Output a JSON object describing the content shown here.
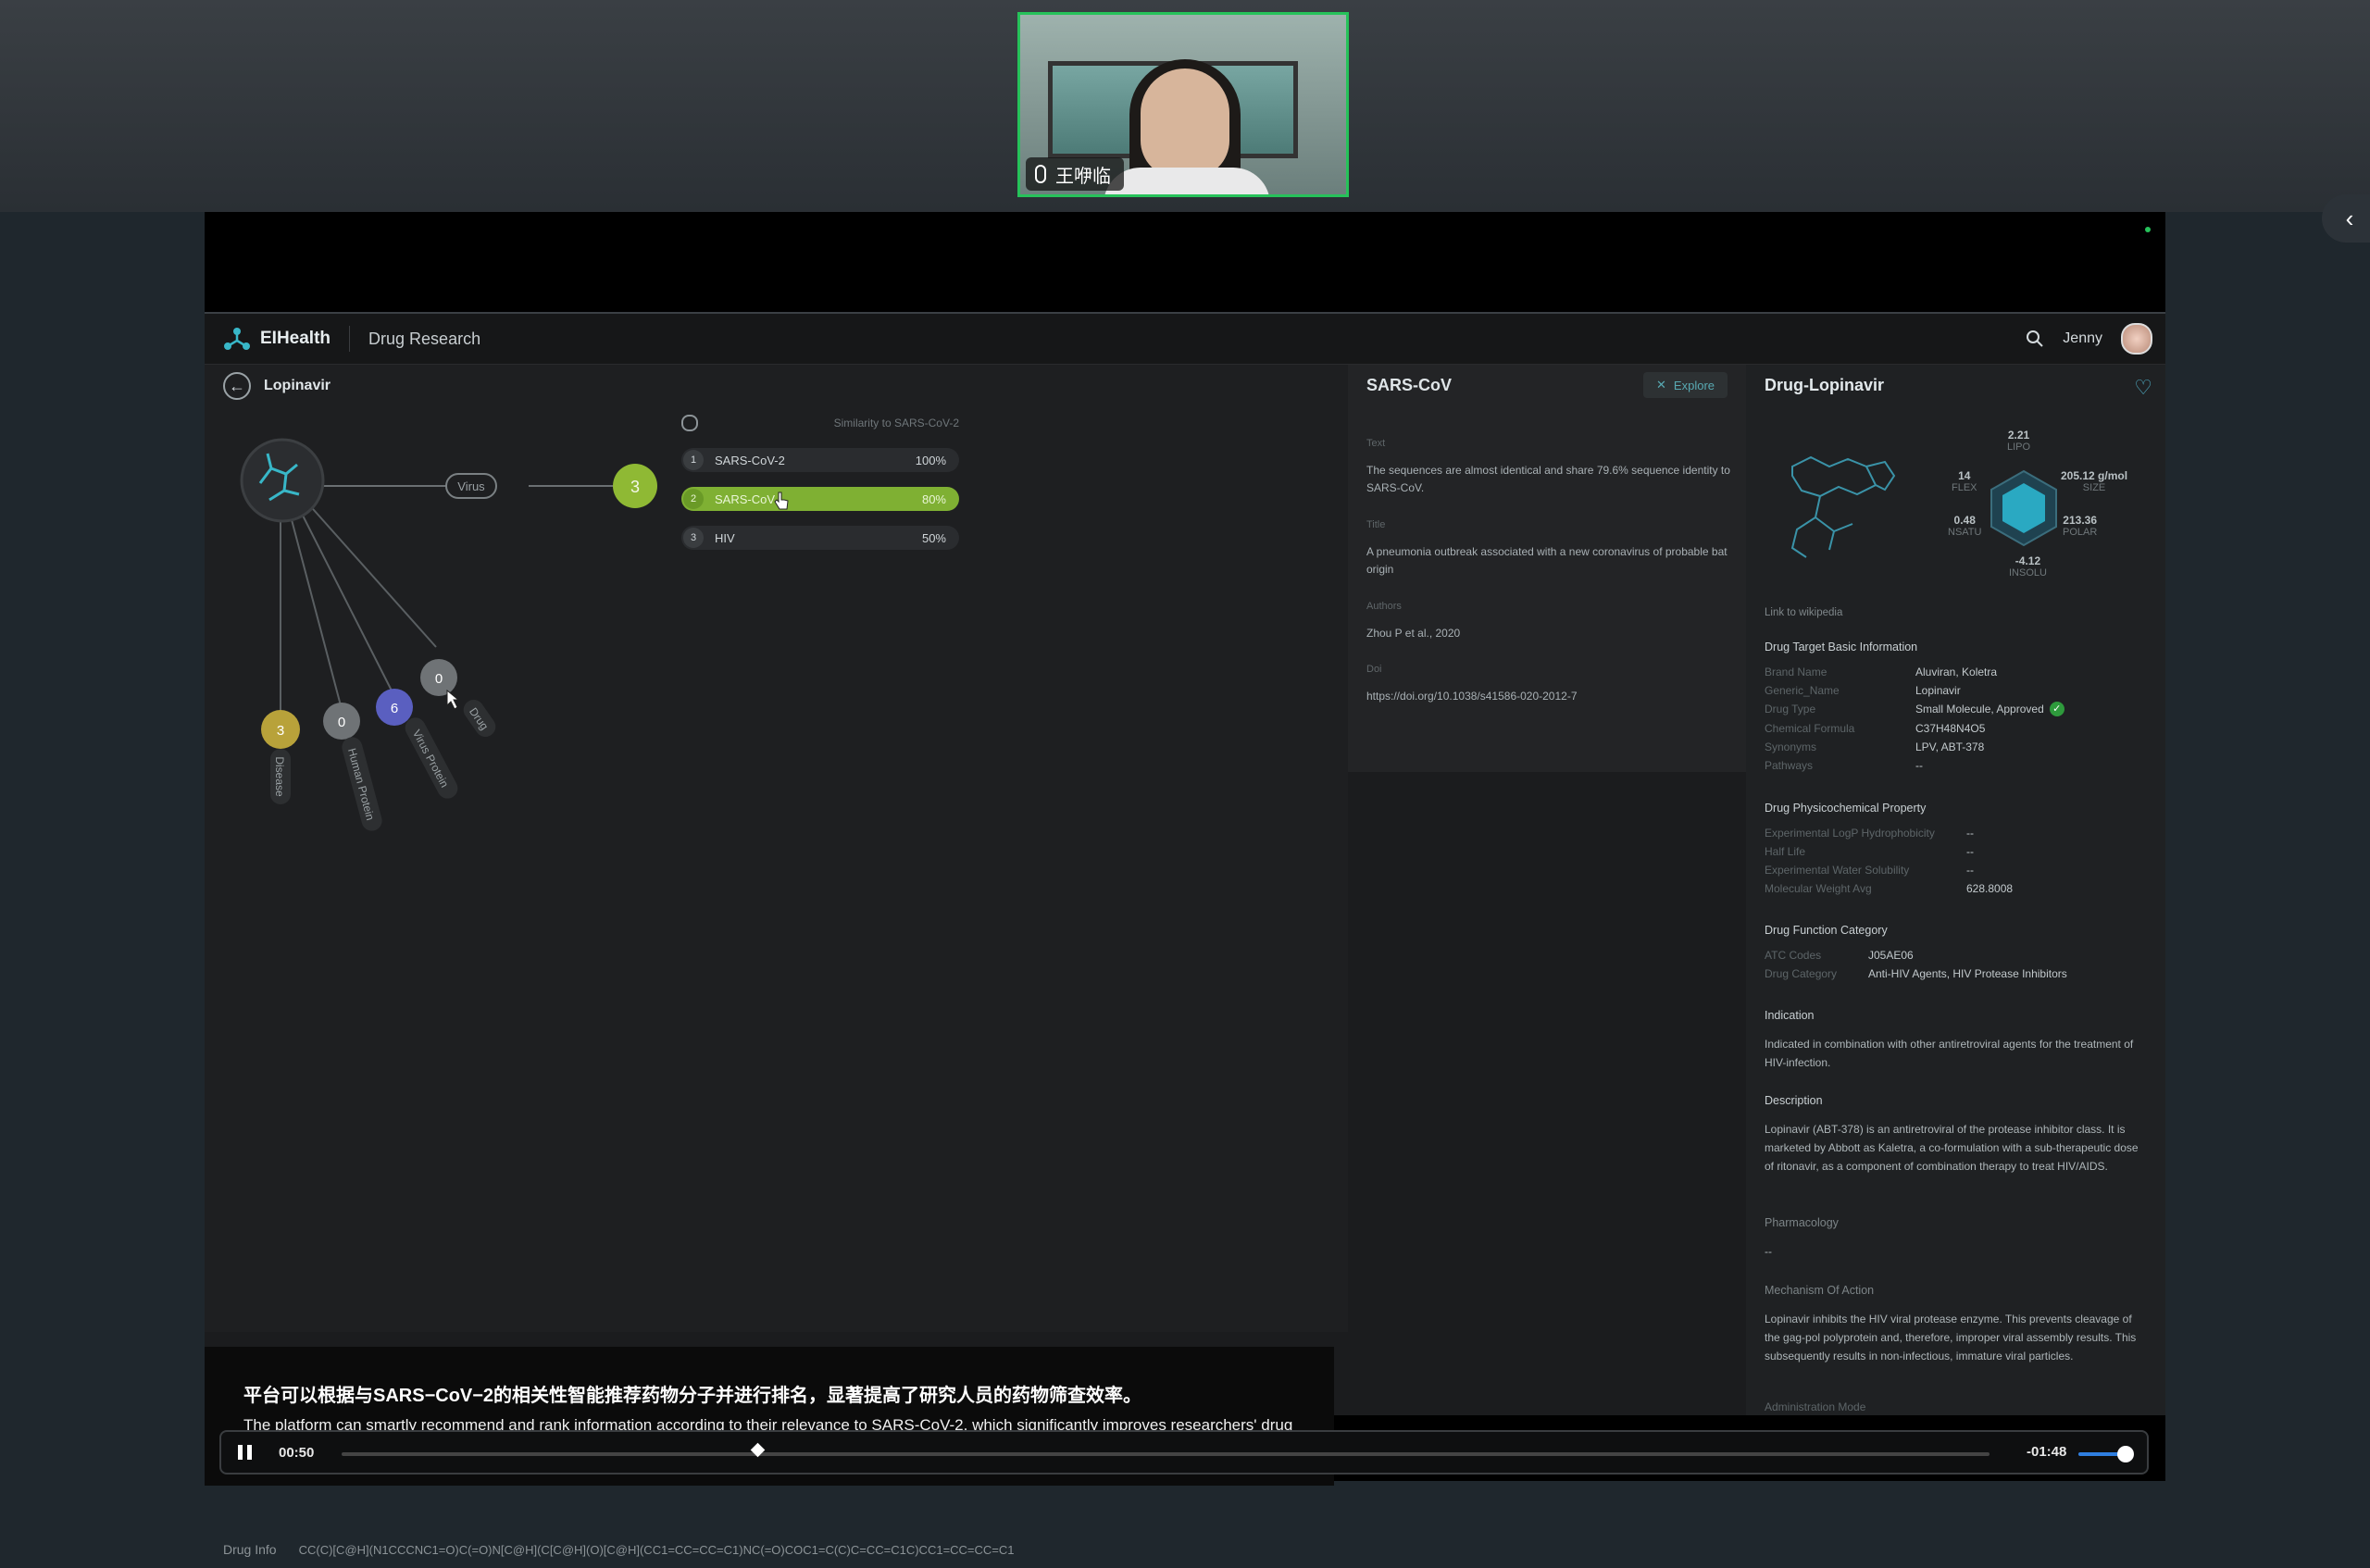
{
  "meeting": {
    "participant_name": "王咿临",
    "collapse_glyph": "‹"
  },
  "app": {
    "brand": "EIHealth",
    "module": "Drug Research",
    "user": "Jenny",
    "back_label": "Lopinavir"
  },
  "graph": {
    "virus_label": "Virus",
    "virus_count": "3",
    "nodes": [
      {
        "count": "3",
        "label": "Disease",
        "color": "#b8a23a"
      },
      {
        "count": "0",
        "label": "Human Protein",
        "color": "#6f7376"
      },
      {
        "count": "6",
        "label": "Virus Protein",
        "color": "#5a5fc0"
      },
      {
        "count": "0",
        "label": "Drug",
        "color": "#6f7376"
      }
    ]
  },
  "ranking": {
    "header": "Similarity to SARS-CoV-2",
    "rows": [
      {
        "rank": "1",
        "name": "SARS-CoV-2",
        "pct": "100%",
        "selected": false
      },
      {
        "rank": "2",
        "name": "SARS-CoV",
        "pct": "80%",
        "selected": true
      },
      {
        "rank": "3",
        "name": "HIV",
        "pct": "50%",
        "selected": false
      }
    ]
  },
  "virus_detail": {
    "title": "SARS-CoV",
    "explore_label": "Explore",
    "text_key": "Text",
    "text_val": "The sequences are almost identical and share 79.6% sequence identity to SARS-CoV.",
    "title_key": "Title",
    "title_val": "A pneumonia outbreak associated with a new coronavirus of probable bat origin",
    "authors_key": "Authors",
    "authors_val": "Zhou P et al., 2020",
    "doi_key": "Doi",
    "doi_val": "https://doi.org/10.1038/s41586-020-2012-7"
  },
  "drug": {
    "title": "Drug-Lopinavir",
    "radar": {
      "lipo": "2.21",
      "lipo_l": "LIPO",
      "size": "205.12 g/mol",
      "size_l": "SIZE",
      "polar": "213.36",
      "polar_l": "POLAR",
      "insolu": "-4.12",
      "insolu_l": "INSOLU",
      "nsatu": "0.48",
      "nsatu_l": "NSATU",
      "flex": "14",
      "flex_l": "FLEX"
    },
    "wiki_link": "Link to wikipedia",
    "basic_title": "Drug Target Basic Information",
    "basic": [
      {
        "k": "Brand Name",
        "v": "Aluviran, Koletra"
      },
      {
        "k": "Generic_Name",
        "v": "Lopinavir"
      },
      {
        "k": "Drug Type",
        "v": "Small Molecule, Approved"
      },
      {
        "k": "Chemical Formula",
        "v": "C37H48N4O5"
      },
      {
        "k": "Synonyms",
        "v": "LPV, ABT-378"
      },
      {
        "k": "Pathways",
        "v": "--"
      }
    ],
    "phys_title": "Drug Physicochemical Property",
    "phys": [
      {
        "k": "Experimental LogP Hydrophobicity",
        "v": "--"
      },
      {
        "k": "Half Life",
        "v": "--"
      },
      {
        "k": "Experimental Water Solubility",
        "v": "--"
      },
      {
        "k": "Molecular Weight Avg",
        "v": "628.8008"
      }
    ],
    "func_title": "Drug Function Category",
    "func": [
      {
        "k": "ATC Codes",
        "v": "J05AE06"
      },
      {
        "k": "Drug Category",
        "v": "Anti-HIV Agents, HIV Protease Inhibitors"
      }
    ],
    "indication_title": "Indication",
    "indication": "Indicated in combination with other antiretroviral agents for the treatment of HIV-infection.",
    "description_title": "Description",
    "description": "Lopinavir (ABT-378) is an antiretroviral of the protease inhibitor class. It is marketed by Abbott as Kaletra, a co-formulation with a sub-therapeutic dose of ritonavir, as a component of combination therapy to treat HIV/AIDS.",
    "pharmacology_title": "Pharmacology",
    "pharmacology": "--",
    "mechanism_title": "Mechanism Of Action",
    "mechanism": "Lopinavir inhibits the HIV viral protease enzyme. This prevents cleavage of the gag-pol polyprotein and, therefore, improper viral assembly results. This subsequently results in non-infectious, immature viral particles.",
    "admin_title": "Administration Mode"
  },
  "drug_info": {
    "label": "Drug Info",
    "smiles": "CC(C)[C@H](N1CCCNC1=O)C(=O)N[C@H](C[C@H](O)[C@H](CC1=CC=CC=C1)NC(=O)COC1=C(C)C=CC=C1C)CC1=CC=CC=C1"
  },
  "caption": {
    "zh": "平台可以根据与SARS−CoV−2的相关性智能推荐药物分子并进行排名，显著提高了研究人员的药物筛查效率。",
    "en": "The platform can smartly recommend and rank information according to their relevance to SARS-CoV-2, which significantly improves researchers' drug screening efficiency."
  },
  "player": {
    "elapsed": "00:50",
    "remaining": "-01:48",
    "progress_fraction": 0.29
  },
  "colors": {
    "accent_green": "#7fb033",
    "teal": "#4fa9c0",
    "speaker_border": "#26c25a"
  }
}
